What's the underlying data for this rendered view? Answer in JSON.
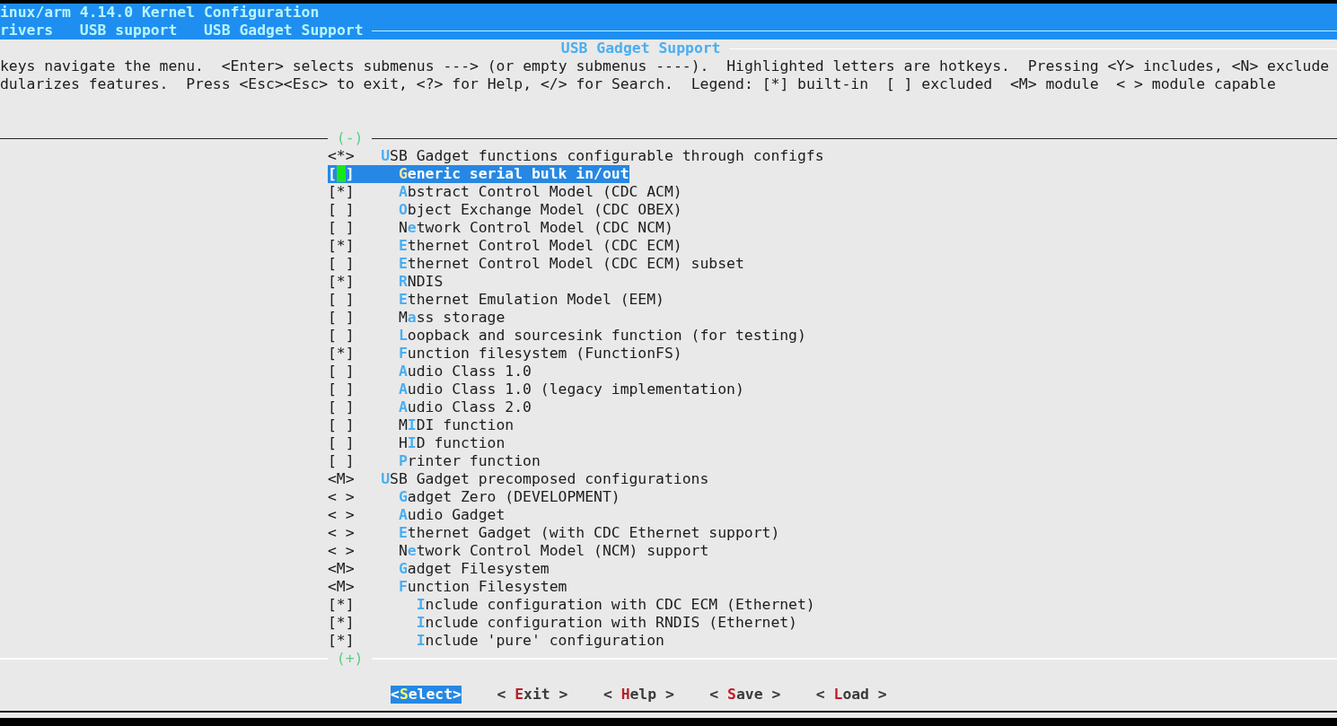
{
  "header": {
    "title": "inux/arm 4.14.0 Kernel Configuration",
    "breadcrumbs": [
      "rivers",
      "USB support",
      "USB Gadget Support"
    ]
  },
  "dialog": {
    "title": "USB Gadget Support",
    "help_lines": [
      "keys navigate the menu.  <Enter> selects submenus ---> (or empty submenus ----).  Highlighted letters are hotkeys.  Pressing <Y> includes, <N> exclude",
      "dularizes features.  Press <Esc><Esc> to exit, <?> for Help, </> for Search.  Legend: [*] built-in  [ ] excluded  <M> module  < > module capable"
    ],
    "scroll_up": "(-)",
    "scroll_down": "(+)"
  },
  "menu": [
    {
      "symbol": "<*>",
      "label": "**U**SB Gadget functions configurable through configfs",
      "selected": false,
      "children": [
        {
          "symbol": "[ ]",
          "label": "**G**eneric serial bulk in/out",
          "selected": true
        },
        {
          "symbol": "[*]",
          "label": "**A**bstract Control Model (CDC ACM)",
          "selected": false
        },
        {
          "symbol": "[ ]",
          "label": "**O**bject Exchange Model (CDC OBEX)",
          "selected": false
        },
        {
          "symbol": "[ ]",
          "label": "N**e**twork Control Model (CDC NCM)",
          "selected": false
        },
        {
          "symbol": "[*]",
          "label": "**E**thernet Control Model (CDC ECM)",
          "selected": false
        },
        {
          "symbol": "[ ]",
          "label": "**E**thernet Control Model (CDC ECM) subset",
          "selected": false
        },
        {
          "symbol": "[*]",
          "label": "**R**NDIS",
          "selected": false
        },
        {
          "symbol": "[ ]",
          "label": "**E**thernet Emulation Model (EEM)",
          "selected": false
        },
        {
          "symbol": "[ ]",
          "label": "M**a**ss storage",
          "selected": false
        },
        {
          "symbol": "[ ]",
          "label": "**L**oopback and sourcesink function (for testing)",
          "selected": false
        },
        {
          "symbol": "[*]",
          "label": "**F**unction filesystem (FunctionFS)",
          "selected": false
        },
        {
          "symbol": "[ ]",
          "label": "**A**udio Class 1.0",
          "selected": false
        },
        {
          "symbol": "[ ]",
          "label": "**A**udio Class 1.0 (legacy implementation)",
          "selected": false
        },
        {
          "symbol": "[ ]",
          "label": "**A**udio Class 2.0",
          "selected": false
        },
        {
          "symbol": "[ ]",
          "label": "M**I**DI function",
          "selected": false
        },
        {
          "symbol": "[ ]",
          "label": "H**I**D function",
          "selected": false
        },
        {
          "symbol": "[ ]",
          "label": "**P**rinter function",
          "selected": false
        }
      ]
    },
    {
      "symbol": "<M>",
      "label": "**U**SB Gadget precomposed configurations",
      "selected": false,
      "children": [
        {
          "symbol": "< >",
          "label": "**G**adget Zero (DEVELOPMENT)",
          "selected": false
        },
        {
          "symbol": "< >",
          "label": "**A**udio Gadget",
          "selected": false
        },
        {
          "symbol": "< >",
          "label": "**E**thernet Gadget (with CDC Ethernet support)",
          "selected": false
        },
        {
          "symbol": "< >",
          "label": "N**e**twork Control Model (NCM) support",
          "selected": false
        },
        {
          "symbol": "<M>",
          "label": "**G**adget Filesystem",
          "selected": false
        },
        {
          "symbol": "<M>",
          "label": "**F**unction Filesystem",
          "selected": false,
          "children": [
            {
              "symbol": "[*]",
              "label": "**I**nclude configuration with CDC ECM (Ethernet)",
              "selected": false
            },
            {
              "symbol": "[*]",
              "label": "**I**nclude configuration with RNDIS (Ethernet)",
              "selected": false
            },
            {
              "symbol": "[*]",
              "label": "**I**nclude 'pure' configuration",
              "selected": false
            }
          ]
        }
      ]
    }
  ],
  "buttons": [
    {
      "label": "<**S**elect>",
      "selected": true
    },
    {
      "label": "< **E**xit >",
      "selected": false
    },
    {
      "label": "< **H**elp >",
      "selected": false
    },
    {
      "label": "< **S**ave >",
      "selected": false
    },
    {
      "label": "< **L**oad >",
      "selected": false
    }
  ]
}
